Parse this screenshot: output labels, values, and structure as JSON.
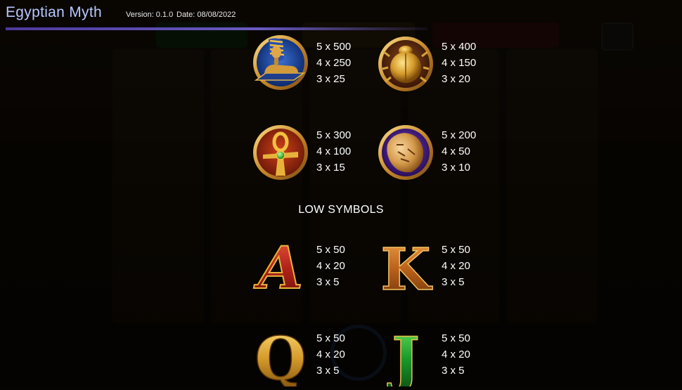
{
  "header": {
    "title": "Egyptian Myth",
    "version": "Version: 0.1.0",
    "date": "Date: 08/08/2022"
  },
  "colors": {
    "title": "#b7c7ff",
    "accent_bar": "#5a4bb0",
    "gold": "#d8a236",
    "text": "#ffffff"
  },
  "high_symbols": [
    {
      "icon": "sphinx-icon",
      "pays": [
        "5 x 500",
        "4 x 250",
        "3 x 25"
      ]
    },
    {
      "icon": "scarab-icon",
      "pays": [
        "5 x 400",
        "4 x 150",
        "3 x 20"
      ]
    },
    {
      "icon": "ankh-icon",
      "pays": [
        "5 x 300",
        "4 x 100",
        "3 x 15"
      ]
    },
    {
      "icon": "vase-icon",
      "pays": [
        "5 x 200",
        "4 x 50",
        "3 x 10"
      ]
    }
  ],
  "low_symbols_heading": "LOW SYMBOLS",
  "low_symbols": [
    {
      "icon": "letter-a-icon",
      "letter": "A",
      "pays": [
        "5 x 50",
        "4 x 20",
        "3 x 5"
      ]
    },
    {
      "icon": "letter-k-icon",
      "letter": "K",
      "pays": [
        "5 x 50",
        "4 x 20",
        "3 x 5"
      ]
    },
    {
      "icon": "letter-q-icon",
      "letter": "Q",
      "pays": [
        "5 x 50",
        "4 x 20",
        "3 x 5"
      ]
    },
    {
      "icon": "letter-j-icon",
      "letter": "J",
      "pays": [
        "5 x 50",
        "4 x 20",
        "3 x 5"
      ]
    }
  ]
}
